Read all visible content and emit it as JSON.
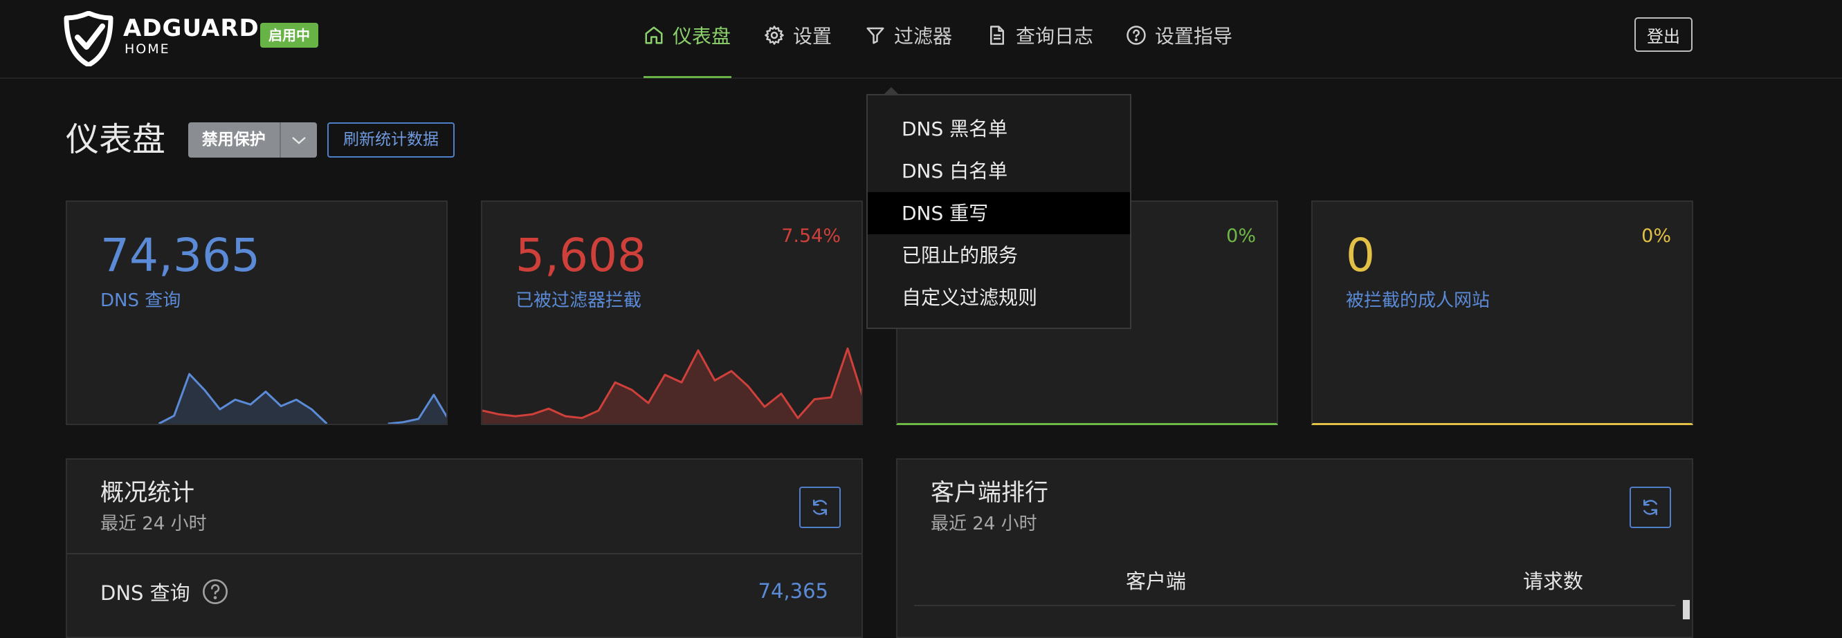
{
  "header": {
    "brand": "ADGUARD",
    "brand_sub": "HOME",
    "status_badge": "启用中",
    "nav": [
      {
        "label": "仪表盘",
        "icon": "home-icon",
        "active": true
      },
      {
        "label": "设置",
        "icon": "gear-icon"
      },
      {
        "label": "过滤器",
        "icon": "filter-icon"
      },
      {
        "label": "查询日志",
        "icon": "document-icon"
      },
      {
        "label": "设置指导",
        "icon": "help-circle-icon"
      }
    ],
    "logout_label": "登出"
  },
  "dropdown": {
    "items": [
      "DNS 黑名单",
      "DNS 白名单",
      "DNS 重写",
      "已阻止的服务",
      "自定义过滤规则"
    ],
    "highlighted_index": 2
  },
  "title_row": {
    "title": "仪表盘",
    "disable_protection": "禁用保护",
    "refresh_stats": "刷新统计数据"
  },
  "stats": [
    {
      "value": "74,365",
      "label": "DNS 查询",
      "percent": "",
      "color": "#5b8ad6"
    },
    {
      "value": "5,608",
      "label": "已被过滤器拦截",
      "percent": "7.54%",
      "color": "#d0403b"
    },
    {
      "value": "",
      "label": "",
      "percent": "0%",
      "color": "#6fba47"
    },
    {
      "value": "0",
      "label": "被拦截的成人网站",
      "percent": "0%",
      "color": "#e3c146",
      "label_color": "#5b8ad6"
    }
  ],
  "overview": {
    "title": "概况统计",
    "subtitle": "最近 24 小时",
    "rows": [
      {
        "label": "DNS 查询",
        "value": "74,365"
      }
    ]
  },
  "top_clients": {
    "title": "客户端排行",
    "subtitle": "最近 24 小时",
    "columns": [
      "客户端",
      "请求数"
    ]
  },
  "sparklines": {
    "dns_queries": [
      0,
      0,
      0,
      0,
      0,
      0,
      0,
      0.1,
      0.62,
      0.42,
      0.18,
      0.3,
      0.24,
      0.4,
      0.22,
      0.3,
      0.18,
      0,
      0,
      0,
      0,
      0,
      0.02,
      0.06,
      0.36,
      0.04
    ],
    "blocked": [
      0.14,
      0.1,
      0.08,
      0.1,
      0.16,
      0.08,
      0.06,
      0.14,
      0.44,
      0.36,
      0.22,
      0.52,
      0.44,
      0.78,
      0.46,
      0.56,
      0.4,
      0.18,
      0.32,
      0.06,
      0.26,
      0.28,
      0.8,
      0.24
    ]
  }
}
